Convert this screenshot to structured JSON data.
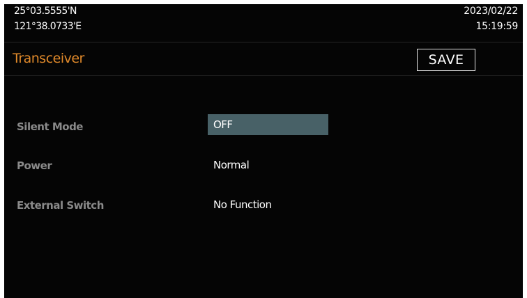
{
  "status_bar": {
    "latitude": "25°03.5555'N",
    "longitude": "121°38.0733'E",
    "date": "2023/02/22",
    "time": "15:19:59"
  },
  "header": {
    "title": "Transceiver",
    "save_label": "SAVE"
  },
  "settings": [
    {
      "label": "Silent Mode",
      "value": "OFF",
      "selected": true
    },
    {
      "label": "Power",
      "value": "Normal",
      "selected": false
    },
    {
      "label": "External Switch",
      "value": "No Function",
      "selected": false
    }
  ],
  "colors": {
    "background": "#050505",
    "title": "#e0892a",
    "label": "#8a8a8a",
    "selection": "#486167",
    "text": "#ffffff"
  }
}
